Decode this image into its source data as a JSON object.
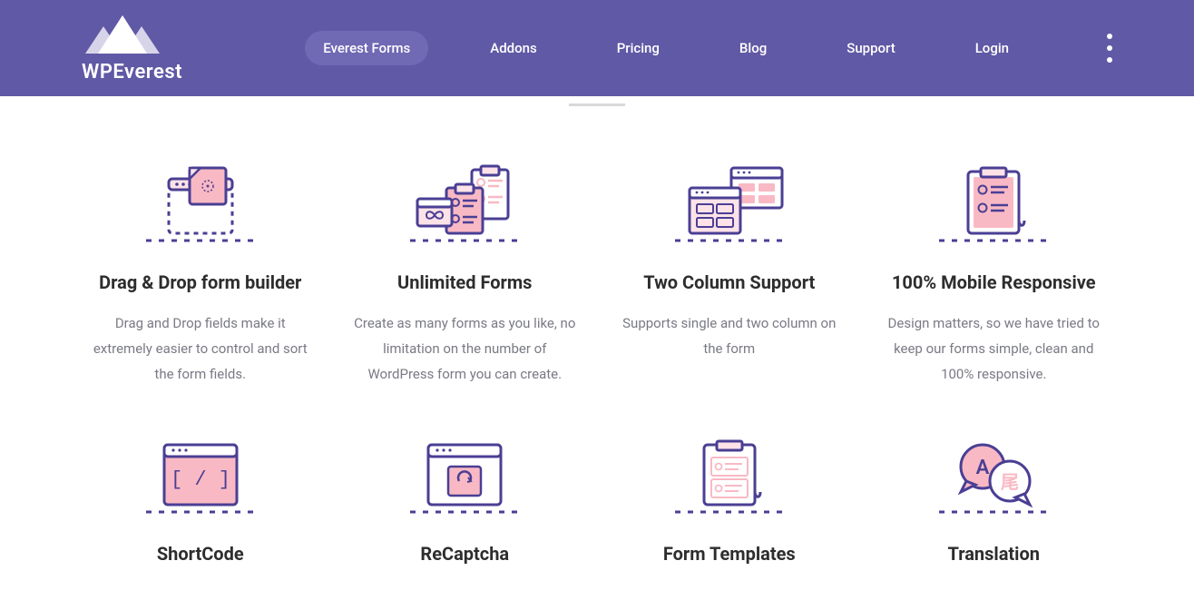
{
  "brand": "WPEverest",
  "nav": [
    {
      "label": "Everest Forms",
      "active": true
    },
    {
      "label": "Addons",
      "active": false
    },
    {
      "label": "Pricing",
      "active": false
    },
    {
      "label": "Blog",
      "active": false
    },
    {
      "label": "Support",
      "active": false
    },
    {
      "label": "Login",
      "active": false
    }
  ],
  "features": [
    {
      "icon": "drag-drop-icon",
      "title": "Drag & Drop form builder",
      "desc": "Drag and Drop fields make it extremely easier to control and sort the form fields."
    },
    {
      "icon": "unlimited-forms-icon",
      "title": "Unlimited Forms",
      "desc": "Create as many forms as you like, no limitation on the number of WordPress form you can create."
    },
    {
      "icon": "two-column-icon",
      "title": "Two Column Support",
      "desc": "Supports single and two column on the form"
    },
    {
      "icon": "mobile-responsive-icon",
      "title": "100% Mobile Responsive",
      "desc": "Design matters, so we have tried to keep our forms simple, clean and 100% responsive."
    },
    {
      "icon": "shortcode-icon",
      "title": "ShortCode",
      "desc": ""
    },
    {
      "icon": "recaptcha-icon",
      "title": "ReCaptcha",
      "desc": ""
    },
    {
      "icon": "form-templates-icon",
      "title": "Form Templates",
      "desc": ""
    },
    {
      "icon": "translation-icon",
      "title": "Translation",
      "desc": ""
    }
  ],
  "colors": {
    "header": "#6059a5",
    "nav_active": "#7069b4",
    "icon_stroke": "#4a3f94",
    "icon_fill": "#f9b9c4",
    "icon_fill_light": "#fde3e8",
    "title": "#2d2d2d",
    "desc": "#7a7a85"
  }
}
